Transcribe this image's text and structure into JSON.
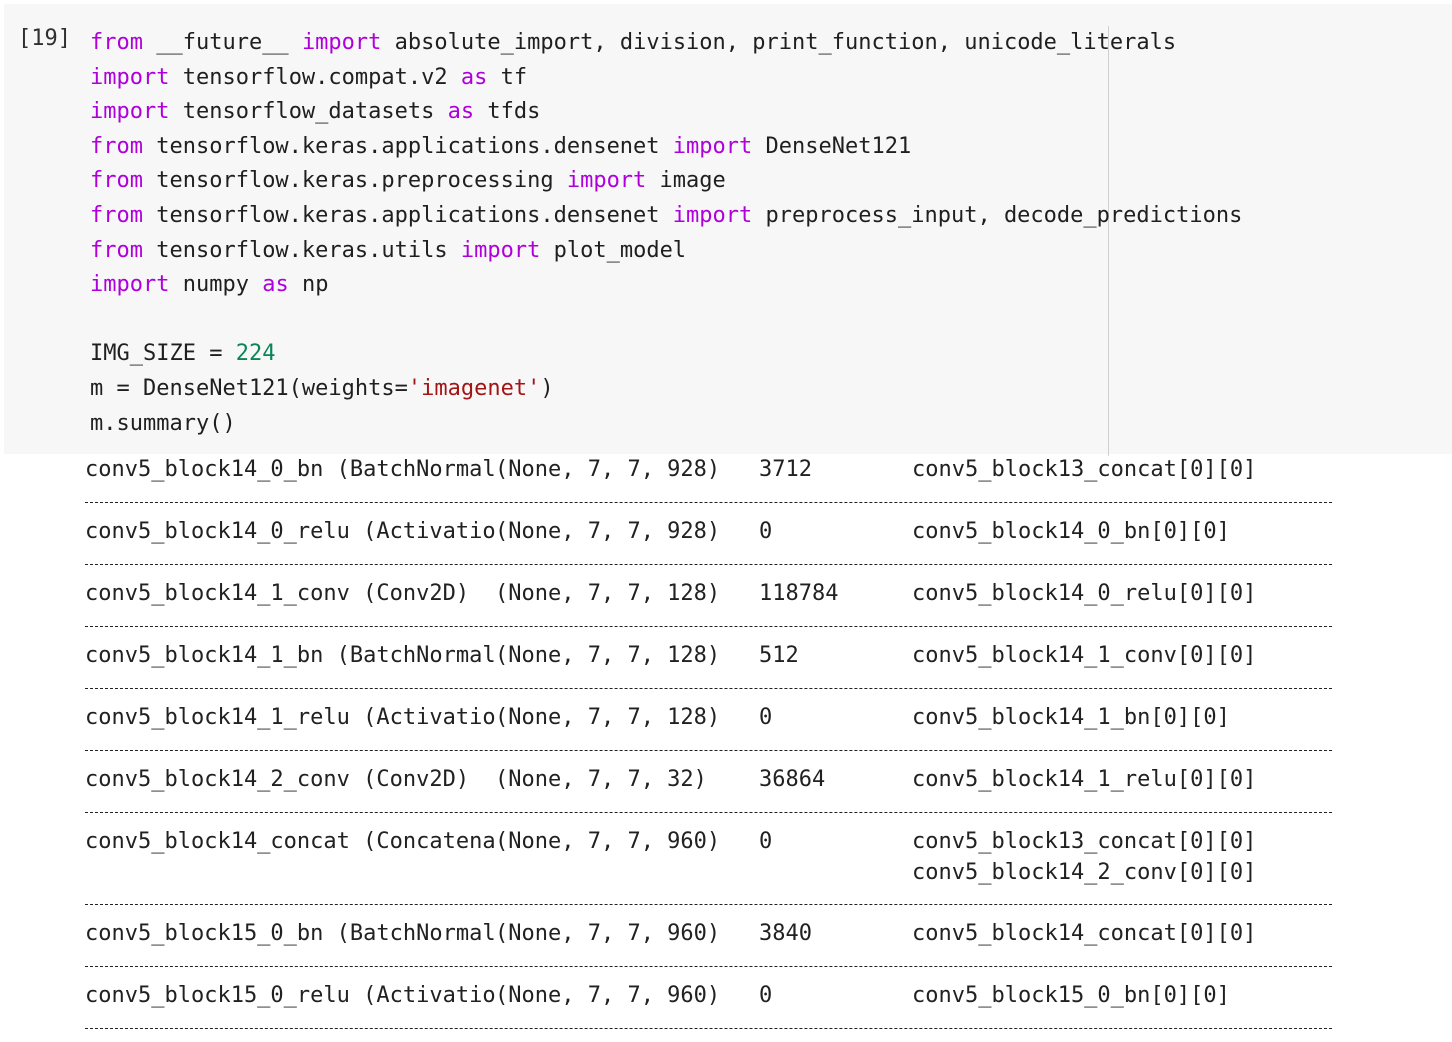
{
  "cell": {
    "prompt": "[19]",
    "code_lines": [
      [
        {
          "t": "from",
          "c": "kw"
        },
        {
          "t": " __future__ ",
          "c": ""
        },
        {
          "t": "import",
          "c": "kw"
        },
        {
          "t": " absolute_import, division, print_function, unicode_literals",
          "c": ""
        }
      ],
      [
        {
          "t": "import",
          "c": "kw"
        },
        {
          "t": " tensorflow.compat.v2 ",
          "c": ""
        },
        {
          "t": "as",
          "c": "kw"
        },
        {
          "t": " tf",
          "c": ""
        }
      ],
      [
        {
          "t": "import",
          "c": "kw"
        },
        {
          "t": " tensorflow_datasets ",
          "c": ""
        },
        {
          "t": "as",
          "c": "kw"
        },
        {
          "t": " tfds",
          "c": ""
        }
      ],
      [
        {
          "t": "from",
          "c": "kw"
        },
        {
          "t": " tensorflow.keras.applications.densenet ",
          "c": ""
        },
        {
          "t": "import",
          "c": "kw"
        },
        {
          "t": " DenseNet121",
          "c": ""
        }
      ],
      [
        {
          "t": "from",
          "c": "kw"
        },
        {
          "t": " tensorflow.keras.preprocessing ",
          "c": ""
        },
        {
          "t": "import",
          "c": "kw"
        },
        {
          "t": " image",
          "c": ""
        }
      ],
      [
        {
          "t": "from",
          "c": "kw"
        },
        {
          "t": " tensorflow.keras.applications.densenet ",
          "c": ""
        },
        {
          "t": "import",
          "c": "kw"
        },
        {
          "t": " preprocess_input, decode_predictions",
          "c": ""
        }
      ],
      [
        {
          "t": "from",
          "c": "kw"
        },
        {
          "t": " tensorflow.keras.utils ",
          "c": ""
        },
        {
          "t": "import",
          "c": "kw"
        },
        {
          "t": " plot_model",
          "c": ""
        }
      ],
      [
        {
          "t": "import",
          "c": "kw"
        },
        {
          "t": " numpy ",
          "c": ""
        },
        {
          "t": "as",
          "c": "kw"
        },
        {
          "t": " np",
          "c": ""
        }
      ],
      [],
      [
        {
          "t": "IMG_SIZE = ",
          "c": ""
        },
        {
          "t": "224",
          "c": "num"
        }
      ],
      [
        {
          "t": "m = DenseNet121(weights=",
          "c": ""
        },
        {
          "t": "'imagenet'",
          "c": "str"
        },
        {
          "t": ")",
          "c": ""
        }
      ],
      [
        {
          "t": "m.summary()",
          "c": ""
        }
      ]
    ]
  },
  "output": {
    "rows": [
      {
        "layer": "conv5_block14_0_bn (BatchNormal",
        "shape": "(None, 7, 7, 928)",
        "params": "3712",
        "connected": [
          "conv5_block13_concat[0][0]"
        ]
      },
      {
        "layer": "conv5_block14_0_relu (Activatio",
        "shape": "(None, 7, 7, 928)",
        "params": "0",
        "connected": [
          "conv5_block14_0_bn[0][0]"
        ]
      },
      {
        "layer": "conv5_block14_1_conv (Conv2D)",
        "shape": "(None, 7, 7, 128)",
        "params": "118784",
        "connected": [
          "conv5_block14_0_relu[0][0]"
        ]
      },
      {
        "layer": "conv5_block14_1_bn (BatchNormal",
        "shape": "(None, 7, 7, 128)",
        "params": "512",
        "connected": [
          "conv5_block14_1_conv[0][0]"
        ]
      },
      {
        "layer": "conv5_block14_1_relu (Activatio",
        "shape": "(None, 7, 7, 128)",
        "params": "0",
        "connected": [
          "conv5_block14_1_bn[0][0]"
        ]
      },
      {
        "layer": "conv5_block14_2_conv (Conv2D)",
        "shape": "(None, 7, 7, 32)",
        "params": "36864",
        "connected": [
          "conv5_block14_1_relu[0][0]"
        ]
      },
      {
        "layer": "conv5_block14_concat (Concatena",
        "shape": "(None, 7, 7, 960)",
        "params": "0",
        "connected": [
          "conv5_block13_concat[0][0]",
          "conv5_block14_2_conv[0][0]"
        ]
      },
      {
        "layer": "conv5_block15_0_bn (BatchNormal",
        "shape": "(None, 7, 7, 960)",
        "params": "3840",
        "connected": [
          "conv5_block14_concat[0][0]"
        ]
      },
      {
        "layer": "conv5_block15_0_relu (Activatio",
        "shape": "(None, 7, 7, 960)",
        "params": "0",
        "connected": [
          "conv5_block15_0_bn[0][0]"
        ]
      }
    ]
  },
  "colors": {
    "keyword": "#af00db",
    "number": "#098658",
    "string": "#a31515",
    "cell_background": "#f7f7f7"
  }
}
